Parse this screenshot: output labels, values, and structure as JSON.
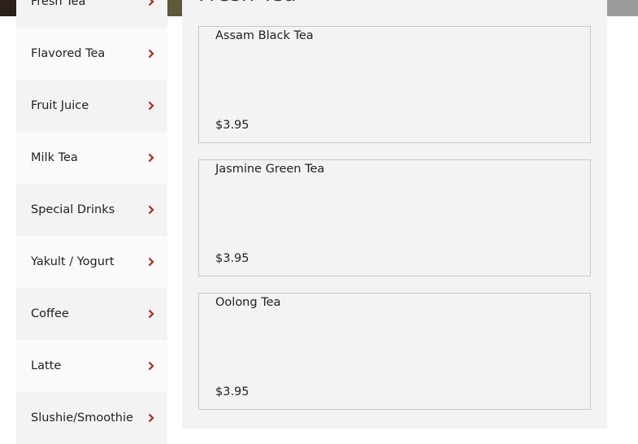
{
  "sidebar": {
    "items": [
      {
        "label": "Fresh Tea"
      },
      {
        "label": "Flavored Tea"
      },
      {
        "label": "Fruit Juice"
      },
      {
        "label": "Milk Tea"
      },
      {
        "label": "Special Drinks"
      },
      {
        "label": "Yakult / Yogurt"
      },
      {
        "label": "Coffee"
      },
      {
        "label": "Latte"
      },
      {
        "label": "Slushie/Smoothie"
      }
    ],
    "chevron_color": "#b3261e"
  },
  "menu": {
    "title": "Fresh Tea",
    "items": [
      {
        "name": "Assam Black Tea",
        "price": "$3.95"
      },
      {
        "name": "Jasmine Green Tea",
        "price": "$3.95"
      },
      {
        "name": "Oolong Tea",
        "price": "$3.95"
      }
    ]
  }
}
